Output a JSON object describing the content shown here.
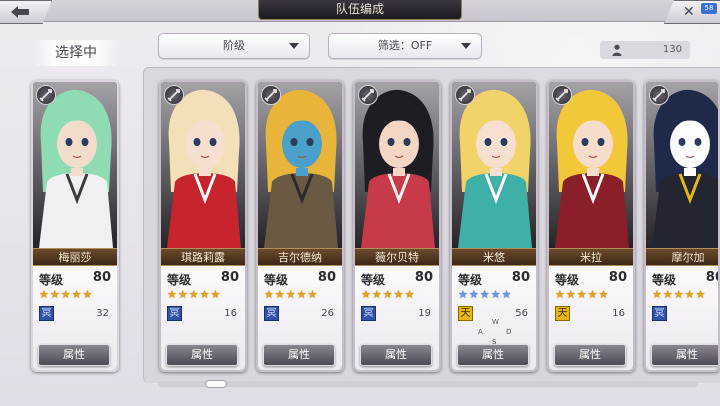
{
  "header": {
    "title": "队伍编成",
    "menu_badge": "58"
  },
  "selecting_label": "选择中",
  "filters": {
    "grade": {
      "label": "阶级"
    },
    "filter": {
      "label": "筛选：OFF"
    }
  },
  "unit_count": "130",
  "characters": [
    {
      "name": "梅丽莎",
      "level_label": "等级",
      "level": "80",
      "stars": "★★★★★",
      "star_color": "gold",
      "element": "冥",
      "element_value": "32",
      "attr_label": "属性",
      "palette": {
        "hair": "#8fdcb4",
        "skin": "#f2dccb",
        "cloth": "#f0f0f2",
        "accent": "#3a3a3a"
      }
    },
    {
      "name": "琪路莉露",
      "level_label": "等级",
      "level": "80",
      "stars": "★★★★★",
      "star_color": "gold",
      "element": "冥",
      "element_value": "16",
      "attr_label": "属性",
      "palette": {
        "hair": "#f3e0b8",
        "skin": "#f6dfcf",
        "cloth": "#c8242e",
        "accent": "#ffffff"
      }
    },
    {
      "name": "吉尔德纳",
      "level_label": "等级",
      "level": "80",
      "stars": "★★★★★",
      "star_color": "gold",
      "element": "冥",
      "element_value": "26",
      "attr_label": "属性",
      "palette": {
        "hair": "#e8b53a",
        "skin": "#4aa0c8",
        "cloth": "#6a5a44",
        "accent": "#2a2a2a"
      }
    },
    {
      "name": "薇尔贝特",
      "level_label": "等级",
      "level": "80",
      "stars": "★★★★★",
      "star_color": "gold",
      "element": "冥",
      "element_value": "19",
      "attr_label": "属性",
      "palette": {
        "hair": "#1f1d24",
        "skin": "#f3d6c4",
        "cloth": "#c73a4a",
        "accent": "#f2f2f2"
      }
    },
    {
      "name": "米悠",
      "level_label": "等级",
      "level": "80",
      "stars": "★★★★★",
      "star_color": "blue",
      "element": "天",
      "element_value": "56",
      "attr_label": "属性",
      "palette": {
        "hair": "#f2d36a",
        "skin": "#f7e0cf",
        "cloth": "#3fb0a8",
        "accent": "#ffffff"
      },
      "compass": {
        "n": "W",
        "w": "A",
        "e": "D",
        "s": "S"
      }
    },
    {
      "name": "米拉",
      "level_label": "等级",
      "level": "80",
      "stars": "★★★★★",
      "star_color": "gold",
      "element": "天",
      "element_value": "16",
      "attr_label": "属性",
      "palette": {
        "hair": "#f0c83a",
        "skin": "#f6dccb",
        "cloth": "#8a1f2a",
        "accent": "#ffffff"
      }
    },
    {
      "name": "摩尔加",
      "level_label": "等级",
      "level": "80",
      "stars": "★★★★★",
      "star_color": "gold",
      "element": "冥",
      "element_value": "",
      "attr_label": "属性",
      "palette": {
        "hair": "#1f2a4a",
        "skin": "#ffffff",
        "cloth": "#232631",
        "accent": "#e6b517"
      }
    }
  ]
}
